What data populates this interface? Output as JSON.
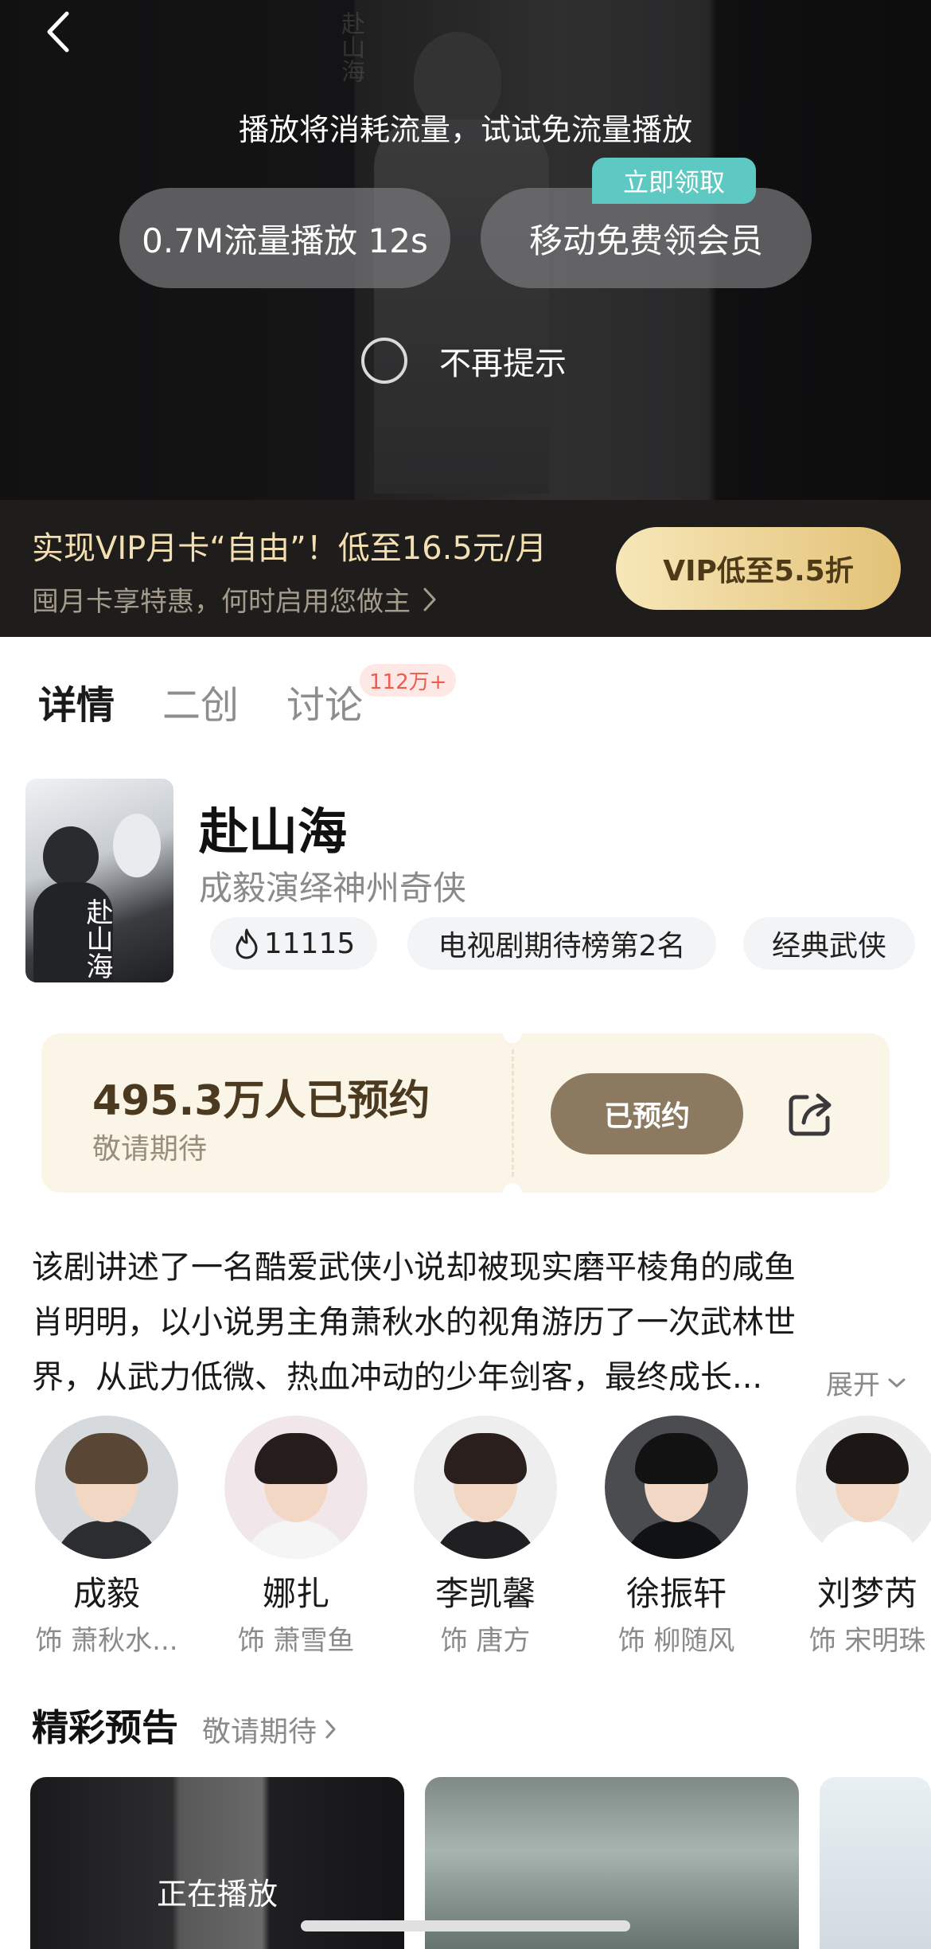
{
  "player": {
    "watermark": "赴山海",
    "notice": "播放将消耗流量，试试免流量播放",
    "data_play_label": "0.7M流量播放 12s",
    "free_member_label": "移动免费领会员",
    "claim_badge": "立即领取",
    "dont_remind_label": "不再提示"
  },
  "vip_banner": {
    "title": "实现VIP月卡“自由”！低至16.5元/月",
    "subtitle": "囤月卡享特惠，何时启用您做主",
    "button_label": "VIP低至5.5折"
  },
  "tabs": [
    {
      "label": "详情"
    },
    {
      "label": "二创"
    },
    {
      "label": "讨论"
    }
  ],
  "discussion_badge": "112万+",
  "show": {
    "poster_text": "赴山海",
    "title": "赴山海",
    "subtitle": "成毅演绎神州奇侠",
    "tags": {
      "heat": "11115",
      "rank": "电视剧期待榜第2名",
      "genre": "经典武侠"
    }
  },
  "reservation": {
    "count_text": "495.3万人已预约",
    "note": "敬请期待",
    "button_label": "已预约"
  },
  "synopsis": {
    "lines": [
      "该剧讲述了一名酷爱武侠小说却被现实磨平棱角的咸鱼",
      "肖明明，以小说男主角萧秋水的视角游历了一次武林世",
      "界，从武力低微、热血冲动的少年剑客，最终成长..."
    ],
    "expand_label": "展开"
  },
  "cast": [
    {
      "name": "成毅",
      "role": "饰 萧秋水..."
    },
    {
      "name": "娜扎",
      "role": "饰 萧雪鱼"
    },
    {
      "name": "李凯馨",
      "role": "饰 唐方"
    },
    {
      "name": "徐振轩",
      "role": "饰 柳随风"
    },
    {
      "name": "刘梦芮",
      "role": "饰 宋明珠"
    }
  ],
  "trailers": {
    "section_title": "精彩预告",
    "section_sub": "敬请期待",
    "now_playing": "正在播放"
  },
  "colors": {
    "vip_gold": "#e3c277",
    "reserve_bg": "#fbf5e8",
    "reserved_button": "#8b7a60",
    "badge_teal": "#5ec9c2",
    "badge_red": "#ef5b4c"
  }
}
